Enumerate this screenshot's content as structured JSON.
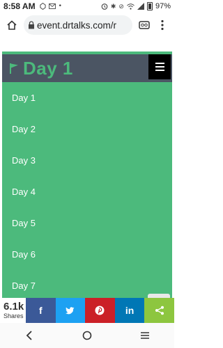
{
  "status": {
    "time": "8:58 AM",
    "battery": "97%"
  },
  "browser": {
    "url": "event.drtalks.com/r"
  },
  "page": {
    "title": "Day 1",
    "menu_items": [
      "Day 1",
      "Day 2",
      "Day 3",
      "Day 4",
      "Day 5",
      "Day 6",
      "Day 7"
    ]
  },
  "share": {
    "count": "6.1k",
    "label": "Shares",
    "buttons": [
      {
        "name": "facebook",
        "glyph": "f",
        "color": "#3b5998"
      },
      {
        "name": "twitter",
        "glyph": "t",
        "color": "#1da1f2"
      },
      {
        "name": "pinterest",
        "glyph": "p",
        "color": "#cb2027"
      },
      {
        "name": "linkedin",
        "glyph": "in",
        "color": "#0077b5"
      },
      {
        "name": "share",
        "glyph": "<",
        "color": "#8dc63f"
      }
    ]
  },
  "colors": {
    "accent_green": "#4cba7c",
    "header_gray": "#4b5563"
  }
}
